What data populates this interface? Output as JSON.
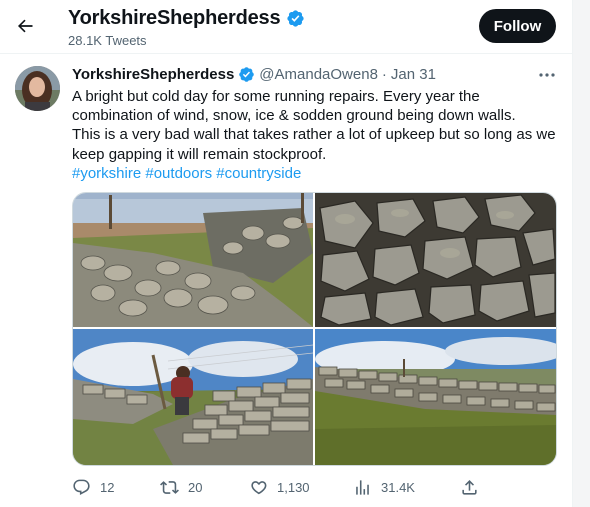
{
  "header": {
    "name": "YorkshireShepherdess",
    "tweet_count": "28.1K Tweets",
    "follow_label": "Follow"
  },
  "icons": {
    "back": "arrow-left-icon",
    "verified": "verified-badge-icon",
    "more": "more-horizontal-icon",
    "reply": "reply-icon",
    "retweet": "retweet-icon",
    "like": "heart-icon",
    "views": "views-icon",
    "share": "share-icon"
  },
  "colors": {
    "accent": "#1d9bf0",
    "text": "#0f1419",
    "muted": "#536471",
    "follow_bg": "#0f1419"
  },
  "tweet": {
    "author_name": "YorkshireShepherdess",
    "handle": "@AmandaOwen8",
    "separator": "·",
    "date": "Jan 31",
    "text_line1": "A bright but cold day for some running repairs. Every year the combination of wind, snow, ice & sodden ground being down walls.",
    "text_line2": "This is a very bad wall that takes rather a lot of upkeep but so long as we keep gapping it will remain stockproof.",
    "hashtags": [
      "#yorkshire",
      "#outdoors",
      "#countryside"
    ],
    "media": [
      {
        "name": "photo-collapsed-wall-moor"
      },
      {
        "name": "photo-stone-rubble-closeup"
      },
      {
        "name": "photo-person-rebuilding-wall"
      },
      {
        "name": "photo-repaired-wall-field"
      }
    ],
    "stats": {
      "replies": "12",
      "retweets": "20",
      "likes": "1,130",
      "views": "31.4K"
    }
  }
}
